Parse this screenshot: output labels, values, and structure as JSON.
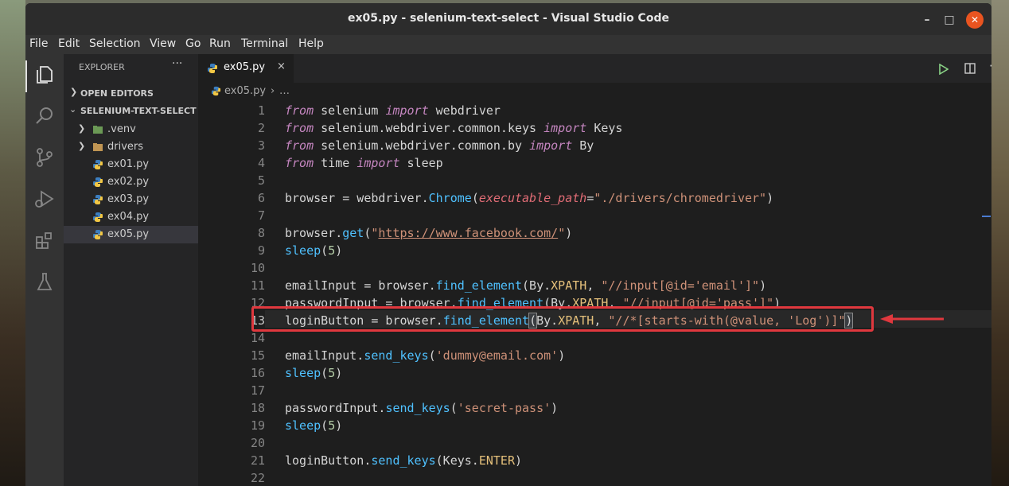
{
  "window": {
    "title": "ex05.py - selenium-text-select - Visual Studio Code"
  },
  "menu": [
    "File",
    "Edit",
    "Selection",
    "View",
    "Go",
    "Run",
    "Terminal",
    "Help"
  ],
  "activity_bar": {
    "icons": [
      "files-icon",
      "search-icon",
      "source-control-icon",
      "run-debug-icon",
      "extensions-icon",
      "testing-icon"
    ]
  },
  "sidebar": {
    "header": "EXPLORER",
    "more": "···",
    "open_editors": "OPEN EDITORS",
    "folder": "SELENIUM-TEXT-SELECT",
    "items": [
      {
        "label": ".venv",
        "type": "folder"
      },
      {
        "label": "drivers",
        "type": "folder"
      },
      {
        "label": "ex01.py",
        "type": "python"
      },
      {
        "label": "ex02.py",
        "type": "python"
      },
      {
        "label": "ex03.py",
        "type": "python"
      },
      {
        "label": "ex04.py",
        "type": "python"
      },
      {
        "label": "ex05.py",
        "type": "python",
        "active": true
      }
    ]
  },
  "tab": {
    "label": "ex05.py",
    "close": "×"
  },
  "breadcrumb": {
    "file": "ex05.py",
    "sep": "›",
    "more": "…"
  },
  "editor": {
    "line_numbers": [
      "1",
      "2",
      "3",
      "4",
      "5",
      "6",
      "7",
      "8",
      "9",
      "10",
      "11",
      "12",
      "13",
      "14",
      "15",
      "16",
      "17",
      "18",
      "19",
      "20",
      "21",
      "22"
    ],
    "highlight_line": "13"
  },
  "colors": {
    "accent_box": "#e0383e",
    "keyword": "#c586c0",
    "string": "#ce9178",
    "function": "#4fc1ff"
  }
}
